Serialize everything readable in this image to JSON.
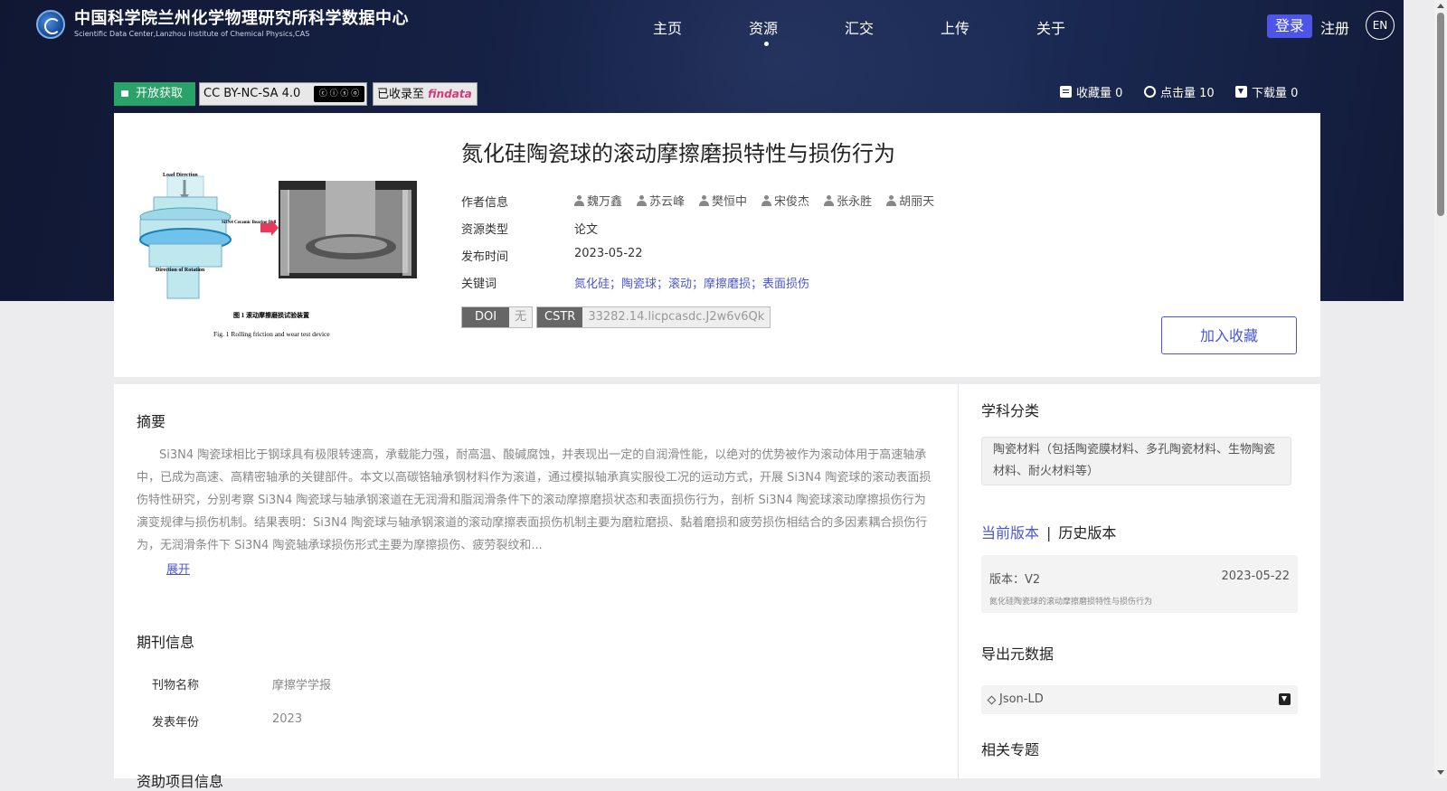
{
  "header": {
    "logo_title": "中国科学院兰州化学物理研究所科学数据中心",
    "logo_subtitle": "Scientific Data Center,Lanzhou Institute of Chemical Physics,CAS",
    "nav": [
      "主页",
      "资源",
      "汇交",
      "上传",
      "关于"
    ],
    "active_nav": "资源",
    "login": "登录",
    "register": "注册",
    "lang": "EN"
  },
  "badges": {
    "open_access": "开放获取",
    "license": "CC BY-NC-SA 4.0",
    "license_img": "cc by nc sa",
    "indexed_prefix": "已收录至",
    "indexed_brand": "findata"
  },
  "stats": {
    "favorites": "收藏量 0",
    "clicks": "点击量 10",
    "downloads": "下载量 0"
  },
  "resource": {
    "title": "氮化硅陶瓷球的滚动摩擦磨损特性与损伤行为",
    "labels": {
      "authors": "作者信息",
      "type": "资源类型",
      "date": "发布时间",
      "keywords": "关键词"
    },
    "authors": [
      "魏万鑫",
      "苏云峰",
      "樊恒中",
      "宋俊杰",
      "张永胜",
      "胡丽天"
    ],
    "type": "论文",
    "date": "2023-05-22",
    "keywords": "氮化硅；陶瓷球；滚动；摩擦磨损；表面损伤",
    "doi_label": "DOI",
    "doi_value": "无",
    "cstr_label": "CSTR",
    "cstr_value": "33282.14.licpcasdc.J2w6v6Qk",
    "add_favorite": "加入收藏",
    "figure": {
      "load_label": "Load Direction",
      "ball_label": "Si3N4 Ceramic Bearing Ball",
      "rotation_label": "Direction of Rotation",
      "caption_cn": "图 1  滚动摩擦磨损试验装置",
      "caption_en": "Fig. 1  Rolling friction and wear test device"
    }
  },
  "abstract": {
    "title": "摘要",
    "text": "Si3N4 陶瓷球相比于钢球具有极限转速高，承载能力强，耐高温、酸碱腐蚀，并表现出一定的自润滑性能，以绝对的优势被作为滚动体用于高速轴承中，已成为高速、高精密轴承的关键部件。本文以高碳铬轴承钢材料作为滚道，通过模拟轴承真实服役工况的运动方式，开展 Si3N4 陶瓷球的滚动表面损伤特性研究，分别考察 Si3N4 陶瓷球与轴承钢滚道在无润滑和脂润滑条件下的滚动摩擦磨损状态和表面损伤行为，剖析 Si3N4 陶瓷球滚动摩擦损伤行为演变规律与损伤机制。结果表明：Si3N4 陶瓷球与轴承钢滚道的滚动摩擦表面损伤机制主要为磨粒磨损、黏着磨损和疲劳损伤相结合的多因素耦合损伤行为，无润滑条件下 Si3N4 陶瓷轴承球损伤形式主要为摩擦损伤、疲劳裂纹和...",
    "expand": "展开"
  },
  "journal": {
    "title": "期刊信息",
    "rows": [
      {
        "label": "刊物名称",
        "value": "摩擦学学报"
      },
      {
        "label": "发表年份",
        "value": "2023"
      }
    ],
    "next_section": "资助项目信息"
  },
  "sidebar": {
    "subject_title": "学科分类",
    "subject": "陶瓷材料（包括陶瓷膜材料、多孔陶瓷材料、生物陶瓷材料、耐火材料等）",
    "version_current": "当前版本",
    "version_sep": "|",
    "version_history": "历史版本",
    "version_label": "版本：V2",
    "version_date": "2023-05-22",
    "version_title": "氮化硅陶瓷球的滚动摩擦磨损特性与损伤行为",
    "export_title": "导出元数据",
    "export_item": "Json-LD",
    "related_title": "相关专题"
  }
}
